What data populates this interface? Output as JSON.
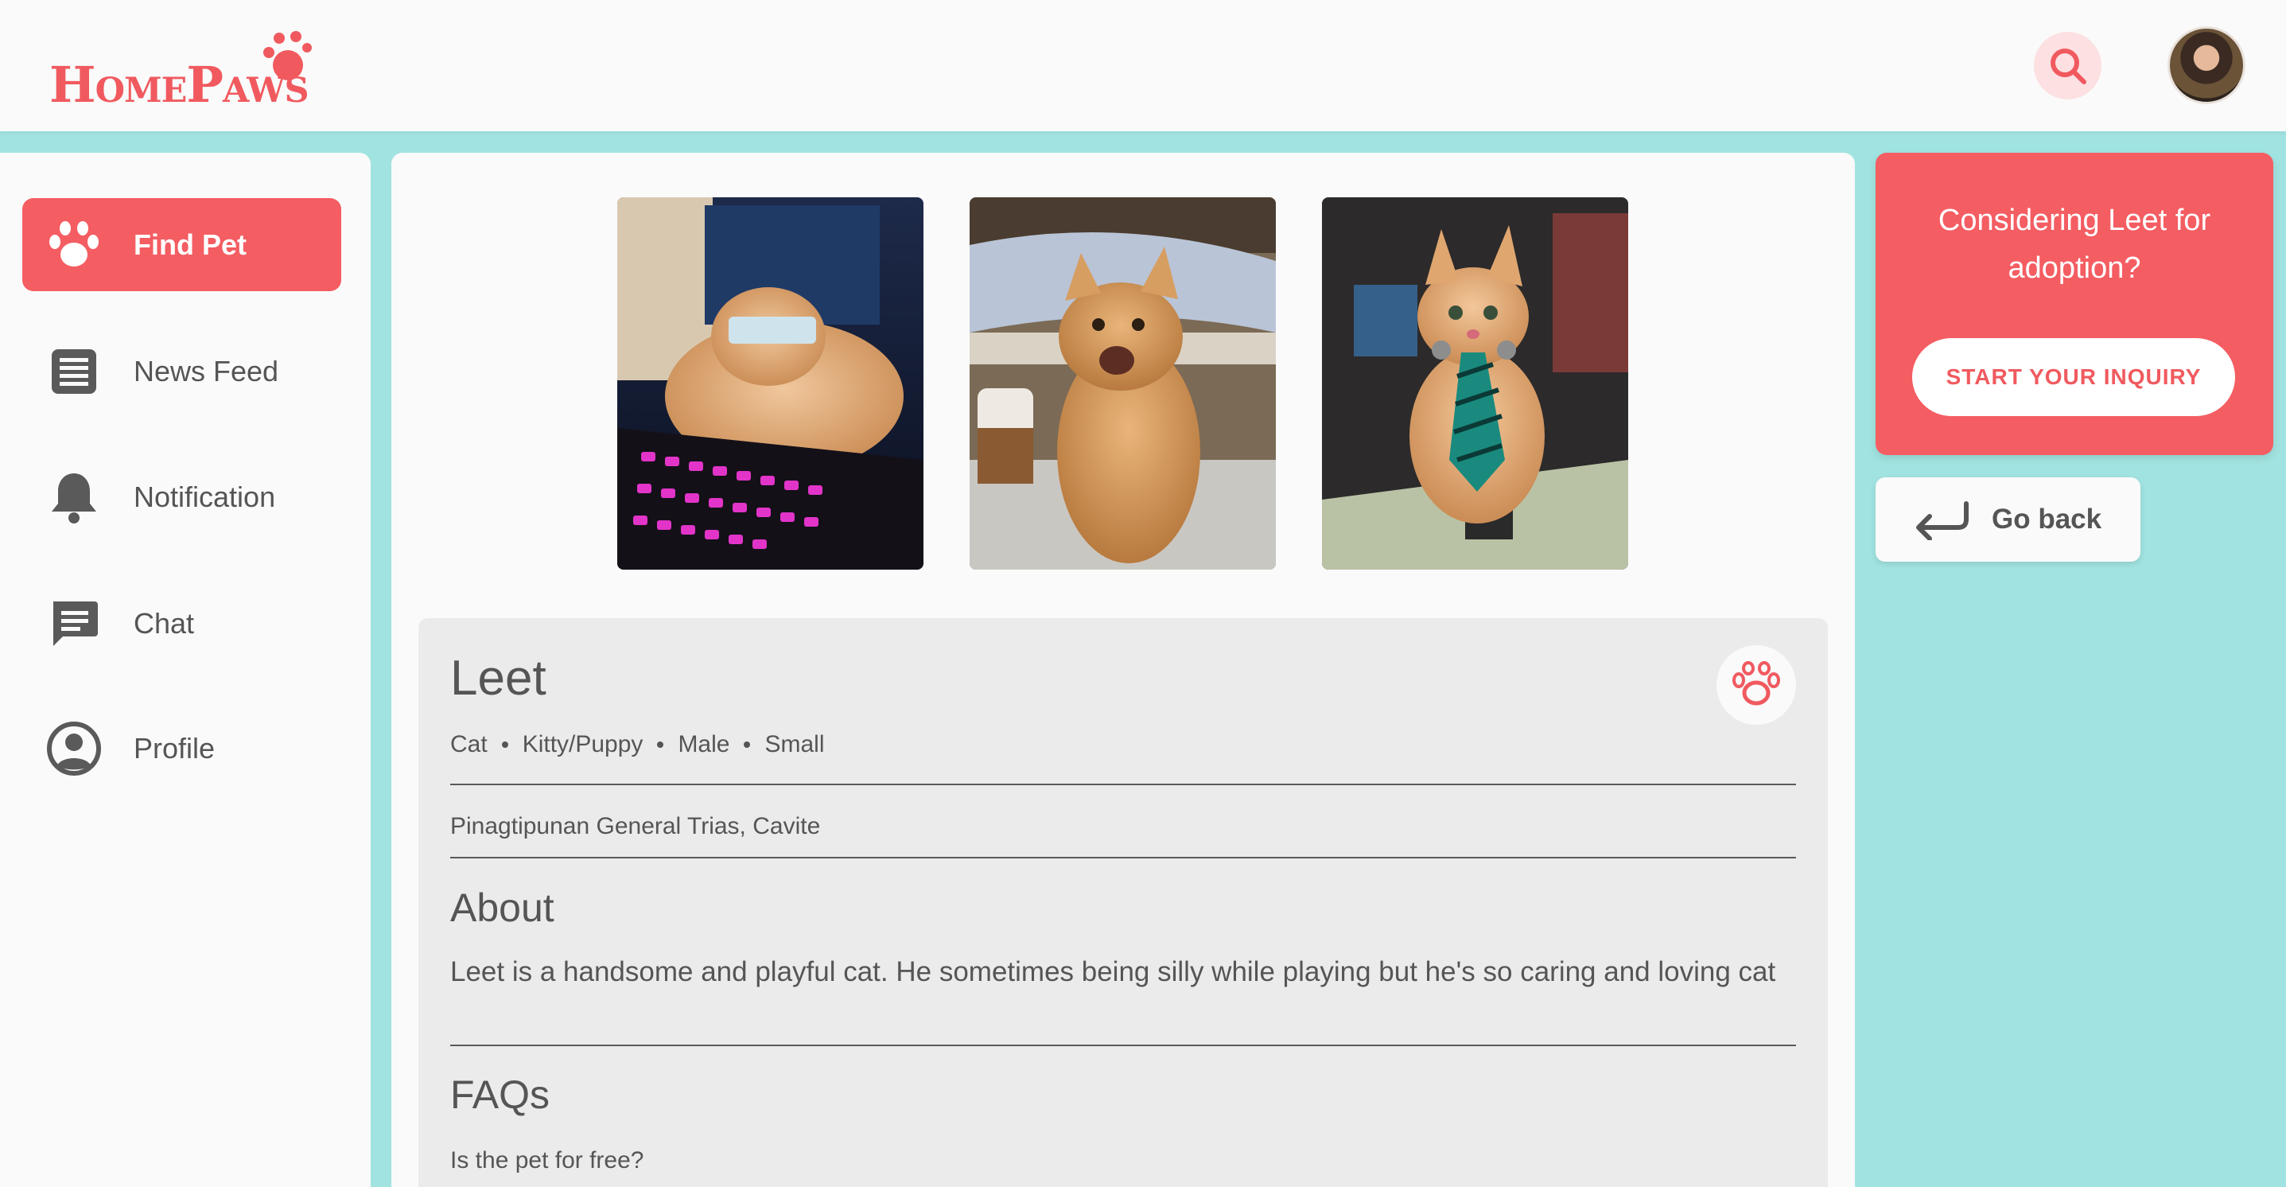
{
  "brand": {
    "logo_text": "HomePaws",
    "accent": "#f45d62",
    "background": "#a1e3e0"
  },
  "header": {
    "search_icon": "search-icon",
    "avatar_alt": "user avatar"
  },
  "sidebar": {
    "items": [
      {
        "label": "Find Pet",
        "icon": "paw-icon",
        "active": true
      },
      {
        "label": "News Feed",
        "icon": "newsfeed-icon",
        "active": false
      },
      {
        "label": "Notification",
        "icon": "bell-icon",
        "active": false
      },
      {
        "label": "Chat",
        "icon": "chat-icon",
        "active": false
      },
      {
        "label": "Profile",
        "icon": "profile-icon",
        "active": false
      }
    ]
  },
  "pet": {
    "name": "Leet",
    "tags": [
      "Cat",
      "Kitty/Puppy",
      "Male",
      "Small"
    ],
    "location": "Pinagtipunan General Trias, Cavite",
    "about_title": "About",
    "about": "Leet is a handsome and playful cat. He sometimes being silly while playing but he's so caring and loving cat",
    "faqs_title": "FAQs",
    "faq_question": "Is the pet for free?"
  },
  "inquiry": {
    "prompt": "Considering Leet for adoption?",
    "button": "START YOUR INQUIRY"
  },
  "goback": {
    "label": "Go back",
    "icon": "return-arrow-icon"
  }
}
